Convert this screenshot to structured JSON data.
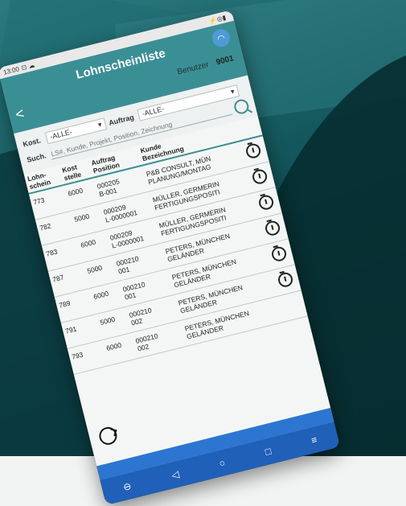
{
  "status_bar": {
    "time": "13:00",
    "icons": "⊡ ☁",
    "right_icons": "⚡◎▮"
  },
  "app": {
    "title": "Lohnscheinliste",
    "back_label": "<",
    "user_label": "Benutzer",
    "user_value": "9001"
  },
  "filters": {
    "kost_label": "Kost.",
    "kost_value": "-ALLE-",
    "auftrag_label": "Auftrag",
    "auftrag_value": "-ALLE-",
    "such_label": "Such.",
    "search_placeholder": "LS#, Kunde, Projekt, Position, Zeichnung"
  },
  "table": {
    "headers": {
      "lohnschein": "Lohn-\nschein",
      "kost": "Kost\nstelle",
      "auftrag": "Auftrag\nPosition",
      "kunde": "Kunde\nBezeichnung"
    },
    "rows": [
      {
        "ls": "773",
        "kost": "6000",
        "auftrag": "000205",
        "position": "B-001",
        "kunde": "P&B CONSULT, MÜN",
        "bez": "PLANUNG/MONTAG"
      },
      {
        "ls": "782",
        "kost": "5000",
        "auftrag": "000209",
        "position": "L-0000001",
        "kunde": "MÜLLER, GERMERIN",
        "bez": "FERTIGUNGSPOSITI"
      },
      {
        "ls": "783",
        "kost": "6000",
        "auftrag": "000209",
        "position": "L-0000001",
        "kunde": "MÜLLER, GERMERIN",
        "bez": "FERTIGUNGSPOSITI"
      },
      {
        "ls": "787",
        "kost": "5000",
        "auftrag": "000210",
        "position": "001",
        "kunde": "PETERS, MÜNCHEN",
        "bez": "GELÄNDER"
      },
      {
        "ls": "789",
        "kost": "6000",
        "auftrag": "000210",
        "position": "001",
        "kunde": "PETERS, MÜNCHEN",
        "bez": "GELÄNDER"
      },
      {
        "ls": "791",
        "kost": "5000",
        "auftrag": "000210",
        "position": "002",
        "kunde": "PETERS, MÜNCHEN",
        "bez": "GELÄNDER"
      },
      {
        "ls": "793",
        "kost": "6000",
        "auftrag": "000210",
        "position": "002",
        "kunde": "PETERS, MÜNCHEN",
        "bez": "GELÄNDER"
      }
    ]
  },
  "nav": {
    "back": "◁",
    "home": "○",
    "recent": "□",
    "menu": "≡",
    "left": "⊖"
  },
  "colors": {
    "appbar": "#3a8f95",
    "nav": "#2060b8",
    "accent": "#2c76d1"
  }
}
